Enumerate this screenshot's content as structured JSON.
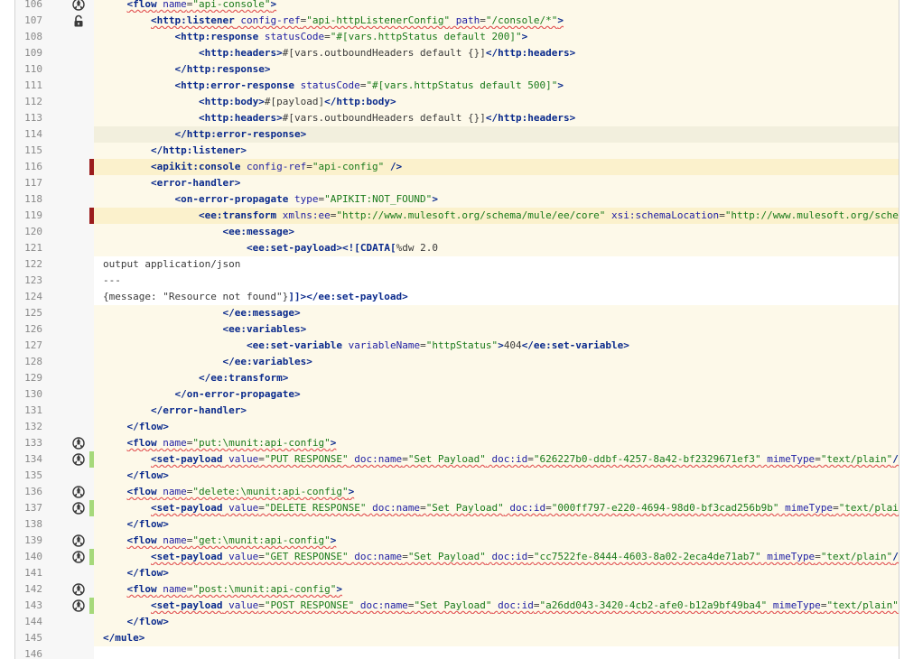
{
  "editor": {
    "lines": [
      {
        "n": "106",
        "icon": "debug-icon",
        "bg": "normal",
        "indent": 1,
        "tokens": [
          {
            "k": "tg",
            "t": "<flow"
          },
          {
            "k": "tx",
            "t": " "
          },
          {
            "k": "an",
            "t": "name"
          },
          {
            "k": "tx",
            "t": "="
          },
          {
            "k": "av",
            "t": "\"api-console\""
          },
          {
            "k": "tg",
            "t": ">"
          }
        ],
        "squiggle": true
      },
      {
        "n": "107",
        "icon": "unlock-icon",
        "bg": "normal",
        "indent": 2,
        "tokens": [
          {
            "k": "tg",
            "t": "<http:listener"
          },
          {
            "k": "tx",
            "t": " "
          },
          {
            "k": "an",
            "t": "config-ref"
          },
          {
            "k": "tx",
            "t": "="
          },
          {
            "k": "av",
            "t": "\"api-httpListenerConfig\""
          },
          {
            "k": "tx",
            "t": " "
          },
          {
            "k": "an",
            "t": "path"
          },
          {
            "k": "tx",
            "t": "="
          },
          {
            "k": "av",
            "t": "\"/console/*\""
          },
          {
            "k": "tg",
            "t": ">"
          }
        ],
        "squiggle": true
      },
      {
        "n": "108",
        "bg": "normal",
        "indent": 3,
        "tokens": [
          {
            "k": "tg",
            "t": "<http:response"
          },
          {
            "k": "tx",
            "t": " "
          },
          {
            "k": "an",
            "t": "statusCode"
          },
          {
            "k": "tx",
            "t": "="
          },
          {
            "k": "av",
            "t": "\"#[vars.httpStatus default 200]\""
          },
          {
            "k": "tg",
            "t": ">"
          }
        ]
      },
      {
        "n": "109",
        "bg": "normal",
        "indent": 4,
        "tokens": [
          {
            "k": "tg",
            "t": "<http:headers>"
          },
          {
            "k": "tx",
            "t": "#[vars.outboundHeaders default {}]"
          },
          {
            "k": "tg",
            "t": "</http:headers>"
          }
        ]
      },
      {
        "n": "110",
        "bg": "normal",
        "indent": 3,
        "tokens": [
          {
            "k": "tg",
            "t": "</http:response>"
          }
        ]
      },
      {
        "n": "111",
        "bg": "normal",
        "indent": 3,
        "tokens": [
          {
            "k": "tg",
            "t": "<http:error-response"
          },
          {
            "k": "tx",
            "t": " "
          },
          {
            "k": "an",
            "t": "statusCode"
          },
          {
            "k": "tx",
            "t": "="
          },
          {
            "k": "av",
            "t": "\"#[vars.httpStatus default 500]\""
          },
          {
            "k": "tg",
            "t": ">"
          }
        ]
      },
      {
        "n": "112",
        "bg": "normal",
        "indent": 4,
        "tokens": [
          {
            "k": "tg",
            "t": "<http:body>"
          },
          {
            "k": "tx",
            "t": "#[payload]"
          },
          {
            "k": "tg",
            "t": "</http:body>"
          }
        ]
      },
      {
        "n": "113",
        "bg": "normal",
        "indent": 4,
        "tokens": [
          {
            "k": "tg",
            "t": "<http:headers>"
          },
          {
            "k": "tx",
            "t": "#[vars.outboundHeaders default {}]"
          },
          {
            "k": "tg",
            "t": "</http:headers>"
          }
        ]
      },
      {
        "n": "114",
        "bg": "caret",
        "indent": 3,
        "tokens": [
          {
            "k": "tg",
            "t": "</http:error-response>"
          }
        ]
      },
      {
        "n": "115",
        "bg": "normal",
        "indent": 2,
        "tokens": [
          {
            "k": "tg",
            "t": "</http:listener>"
          }
        ]
      },
      {
        "n": "116",
        "mark": "red",
        "bg": "warn",
        "indent": 2,
        "tokens": [
          {
            "k": "tg",
            "t": "<apikit:console"
          },
          {
            "k": "tx",
            "t": " "
          },
          {
            "k": "an",
            "t": "config-ref"
          },
          {
            "k": "tx",
            "t": "="
          },
          {
            "k": "av",
            "t": "\"api-config\""
          },
          {
            "k": "tx",
            "t": " "
          },
          {
            "k": "tg",
            "t": "/>"
          }
        ]
      },
      {
        "n": "117",
        "bg": "normal",
        "indent": 2,
        "tokens": [
          {
            "k": "tg",
            "t": "<error-handler>"
          }
        ]
      },
      {
        "n": "118",
        "bg": "normal",
        "indent": 3,
        "tokens": [
          {
            "k": "tg",
            "t": "<on-error-propagate"
          },
          {
            "k": "tx",
            "t": " "
          },
          {
            "k": "an",
            "t": "type"
          },
          {
            "k": "tx",
            "t": "="
          },
          {
            "k": "av",
            "t": "\"APIKIT:NOT_FOUND\""
          },
          {
            "k": "tg",
            "t": ">"
          }
        ]
      },
      {
        "n": "119",
        "mark": "red",
        "bg": "warn",
        "indent": 4,
        "tokens": [
          {
            "k": "tg",
            "t": "<ee:transform"
          },
          {
            "k": "tx",
            "t": " "
          },
          {
            "k": "an",
            "t": "xmlns:ee"
          },
          {
            "k": "tx",
            "t": "="
          },
          {
            "k": "av",
            "t": "\"http://www.mulesoft.org/schema/mule/ee/core\""
          },
          {
            "k": "tx",
            "t": " "
          },
          {
            "k": "an",
            "t": "xsi:schemaLocation"
          },
          {
            "k": "tx",
            "t": "="
          },
          {
            "k": "av",
            "t": "\"http://www.mulesoft.org/schem"
          }
        ]
      },
      {
        "n": "120",
        "bg": "normal",
        "indent": 5,
        "tokens": [
          {
            "k": "tg",
            "t": "<ee:message>"
          }
        ]
      },
      {
        "n": "121",
        "bg": "normal",
        "indent": 6,
        "tokens": [
          {
            "k": "tg",
            "t": "<ee:set-payload>"
          },
          {
            "k": "tg",
            "t": "<![CDATA["
          },
          {
            "k": "tx",
            "t": "%dw 2.0"
          }
        ]
      },
      {
        "n": "122",
        "bg": "plain",
        "indent": 0,
        "tokens": [
          {
            "k": "tx",
            "t": "output application/json"
          }
        ]
      },
      {
        "n": "123",
        "bg": "plain",
        "indent": 0,
        "tokens": [
          {
            "k": "tx",
            "t": "---"
          }
        ]
      },
      {
        "n": "124",
        "bg": "plain",
        "indent": 0,
        "tokens": [
          {
            "k": "tx",
            "t": "{message: \"Resource not found\"}"
          },
          {
            "k": "tg",
            "t": "]]>"
          },
          {
            "k": "tg",
            "t": "</ee:set-payload>"
          }
        ]
      },
      {
        "n": "125",
        "bg": "normal",
        "indent": 5,
        "tokens": [
          {
            "k": "tg",
            "t": "</ee:message>"
          }
        ]
      },
      {
        "n": "126",
        "bg": "normal",
        "indent": 5,
        "tokens": [
          {
            "k": "tg",
            "t": "<ee:variables>"
          }
        ]
      },
      {
        "n": "127",
        "bg": "normal",
        "indent": 6,
        "tokens": [
          {
            "k": "tg",
            "t": "<ee:set-variable"
          },
          {
            "k": "tx",
            "t": " "
          },
          {
            "k": "an",
            "t": "variableName"
          },
          {
            "k": "tx",
            "t": "="
          },
          {
            "k": "av",
            "t": "\"httpStatus\""
          },
          {
            "k": "tg",
            "t": ">"
          },
          {
            "k": "tx",
            "t": "404"
          },
          {
            "k": "tg",
            "t": "</ee:set-variable>"
          }
        ]
      },
      {
        "n": "128",
        "bg": "normal",
        "indent": 5,
        "tokens": [
          {
            "k": "tg",
            "t": "</ee:variables>"
          }
        ]
      },
      {
        "n": "129",
        "bg": "normal",
        "indent": 4,
        "tokens": [
          {
            "k": "tg",
            "t": "</ee:transform>"
          }
        ]
      },
      {
        "n": "130",
        "bg": "normal",
        "indent": 3,
        "tokens": [
          {
            "k": "tg",
            "t": "</on-error-propagate>"
          }
        ]
      },
      {
        "n": "131",
        "bg": "normal",
        "indent": 2,
        "tokens": [
          {
            "k": "tg",
            "t": "</error-handler>"
          }
        ]
      },
      {
        "n": "132",
        "bg": "normal",
        "indent": 1,
        "tokens": [
          {
            "k": "tg",
            "t": "</flow>"
          }
        ]
      },
      {
        "n": "133",
        "icon": "debug-icon",
        "bg": "normal",
        "indent": 1,
        "tokens": [
          {
            "k": "tg",
            "t": "<flow"
          },
          {
            "k": "tx",
            "t": " "
          },
          {
            "k": "an",
            "t": "name"
          },
          {
            "k": "tx",
            "t": "="
          },
          {
            "k": "av",
            "t": "\"put:\\munit:api-config\""
          },
          {
            "k": "tg",
            "t": ">"
          }
        ],
        "squiggle": true
      },
      {
        "n": "134",
        "icon": "debug-icon",
        "mark": "green",
        "bg": "normal",
        "indent": 2,
        "tokens": [
          {
            "k": "tg",
            "t": "<set-payload"
          },
          {
            "k": "tx",
            "t": " "
          },
          {
            "k": "an",
            "t": "value"
          },
          {
            "k": "tx",
            "t": "="
          },
          {
            "k": "av",
            "t": "\"PUT RESPONSE\""
          },
          {
            "k": "tx",
            "t": " "
          },
          {
            "k": "an",
            "t": "doc:name"
          },
          {
            "k": "tx",
            "t": "="
          },
          {
            "k": "av",
            "t": "\"Set Payload\""
          },
          {
            "k": "tx",
            "t": " "
          },
          {
            "k": "an",
            "t": "doc:id"
          },
          {
            "k": "tx",
            "t": "="
          },
          {
            "k": "av",
            "t": "\"626227b0-ddbf-4257-8a42-bf2329671ef3\""
          },
          {
            "k": "tx",
            "t": " "
          },
          {
            "k": "an",
            "t": "mimeType"
          },
          {
            "k": "tx",
            "t": "="
          },
          {
            "k": "av",
            "t": "\"text/plain\""
          },
          {
            "k": "tg",
            "t": "/>"
          }
        ],
        "squiggle": true
      },
      {
        "n": "135",
        "bg": "normal",
        "indent": 1,
        "tokens": [
          {
            "k": "tg",
            "t": "</flow>"
          }
        ]
      },
      {
        "n": "136",
        "icon": "debug-icon",
        "bg": "normal",
        "indent": 1,
        "tokens": [
          {
            "k": "tg",
            "t": "<flow"
          },
          {
            "k": "tx",
            "t": " "
          },
          {
            "k": "an",
            "t": "name"
          },
          {
            "k": "tx",
            "t": "="
          },
          {
            "k": "av",
            "t": "\"delete:\\munit:api-config\""
          },
          {
            "k": "tg",
            "t": ">"
          }
        ],
        "squiggle": true
      },
      {
        "n": "137",
        "icon": "debug-icon",
        "mark": "green",
        "bg": "normal",
        "indent": 2,
        "tokens": [
          {
            "k": "tg",
            "t": "<set-payload"
          },
          {
            "k": "tx",
            "t": " "
          },
          {
            "k": "an",
            "t": "value"
          },
          {
            "k": "tx",
            "t": "="
          },
          {
            "k": "av",
            "t": "\"DELETE RESPONSE\""
          },
          {
            "k": "tx",
            "t": " "
          },
          {
            "k": "an",
            "t": "doc:name"
          },
          {
            "k": "tx",
            "t": "="
          },
          {
            "k": "av",
            "t": "\"Set Payload\""
          },
          {
            "k": "tx",
            "t": " "
          },
          {
            "k": "an",
            "t": "doc:id"
          },
          {
            "k": "tx",
            "t": "="
          },
          {
            "k": "av",
            "t": "\"000ff797-e220-4694-98d0-bf3cad256b9b\""
          },
          {
            "k": "tx",
            "t": " "
          },
          {
            "k": "an",
            "t": "mimeType"
          },
          {
            "k": "tx",
            "t": "="
          },
          {
            "k": "av",
            "t": "\"text/plain\""
          }
        ],
        "squiggle": true
      },
      {
        "n": "138",
        "bg": "normal",
        "indent": 1,
        "tokens": [
          {
            "k": "tg",
            "t": "</flow>"
          }
        ]
      },
      {
        "n": "139",
        "icon": "debug-icon",
        "bg": "normal",
        "indent": 1,
        "tokens": [
          {
            "k": "tg",
            "t": "<flow"
          },
          {
            "k": "tx",
            "t": " "
          },
          {
            "k": "an",
            "t": "name"
          },
          {
            "k": "tx",
            "t": "="
          },
          {
            "k": "av",
            "t": "\"get:\\munit:api-config\""
          },
          {
            "k": "tg",
            "t": ">"
          }
        ],
        "squiggle": true
      },
      {
        "n": "140",
        "icon": "debug-icon",
        "mark": "green",
        "bg": "normal",
        "indent": 2,
        "tokens": [
          {
            "k": "tg",
            "t": "<set-payload"
          },
          {
            "k": "tx",
            "t": " "
          },
          {
            "k": "an",
            "t": "value"
          },
          {
            "k": "tx",
            "t": "="
          },
          {
            "k": "av",
            "t": "\"GET RESPONSE\""
          },
          {
            "k": "tx",
            "t": " "
          },
          {
            "k": "an",
            "t": "doc:name"
          },
          {
            "k": "tx",
            "t": "="
          },
          {
            "k": "av",
            "t": "\"Set Payload\""
          },
          {
            "k": "tx",
            "t": " "
          },
          {
            "k": "an",
            "t": "doc:id"
          },
          {
            "k": "tx",
            "t": "="
          },
          {
            "k": "av",
            "t": "\"cc7522fe-8444-4603-8a02-2eca4de71ab7\""
          },
          {
            "k": "tx",
            "t": " "
          },
          {
            "k": "an",
            "t": "mimeType"
          },
          {
            "k": "tx",
            "t": "="
          },
          {
            "k": "av",
            "t": "\"text/plain\""
          },
          {
            "k": "tg",
            "t": "/>"
          }
        ],
        "squiggle": true
      },
      {
        "n": "141",
        "bg": "normal",
        "indent": 1,
        "tokens": [
          {
            "k": "tg",
            "t": "</flow>"
          }
        ]
      },
      {
        "n": "142",
        "icon": "debug-icon",
        "bg": "normal",
        "indent": 1,
        "tokens": [
          {
            "k": "tg",
            "t": "<flow"
          },
          {
            "k": "tx",
            "t": " "
          },
          {
            "k": "an",
            "t": "name"
          },
          {
            "k": "tx",
            "t": "="
          },
          {
            "k": "av",
            "t": "\"post:\\munit:api-config\""
          },
          {
            "k": "tg",
            "t": ">"
          }
        ],
        "squiggle": true
      },
      {
        "n": "143",
        "icon": "debug-icon",
        "mark": "green",
        "bg": "normal",
        "indent": 2,
        "tokens": [
          {
            "k": "tg",
            "t": "<set-payload"
          },
          {
            "k": "tx",
            "t": " "
          },
          {
            "k": "an",
            "t": "value"
          },
          {
            "k": "tx",
            "t": "="
          },
          {
            "k": "av",
            "t": "\"POST RESPONSE\""
          },
          {
            "k": "tx",
            "t": " "
          },
          {
            "k": "an",
            "t": "doc:name"
          },
          {
            "k": "tx",
            "t": "="
          },
          {
            "k": "av",
            "t": "\"Set Payload\""
          },
          {
            "k": "tx",
            "t": " "
          },
          {
            "k": "an",
            "t": "doc:id"
          },
          {
            "k": "tx",
            "t": "="
          },
          {
            "k": "av",
            "t": "\"a26dd043-3420-4cb2-afe0-b12a9bf49ba4\""
          },
          {
            "k": "tx",
            "t": " "
          },
          {
            "k": "an",
            "t": "mimeType"
          },
          {
            "k": "tx",
            "t": "="
          },
          {
            "k": "av",
            "t": "\"text/plain\""
          },
          {
            "k": "tg",
            "t": "/"
          }
        ],
        "squiggle": true
      },
      {
        "n": "144",
        "bg": "normal",
        "indent": 1,
        "tokens": [
          {
            "k": "tg",
            "t": "</flow>"
          }
        ]
      },
      {
        "n": "145",
        "bg": "normal",
        "indent": 0,
        "tokens": [
          {
            "k": "tg",
            "t": "</mule>"
          }
        ]
      },
      {
        "n": "146",
        "bg": "plain",
        "indent": 0,
        "tokens": []
      }
    ]
  },
  "colors": {
    "tag": "#0a2a8c",
    "attribute_name": "#1f1fa3",
    "attribute_value": "#1a7a1a",
    "text": "#3a3a3a",
    "line_number": "#8a8a8a",
    "squiggle": "#e25555",
    "change_marker_red": "#9b1c1c",
    "change_marker_green": "#a6d97a",
    "code_background": "#fdf9e9"
  }
}
